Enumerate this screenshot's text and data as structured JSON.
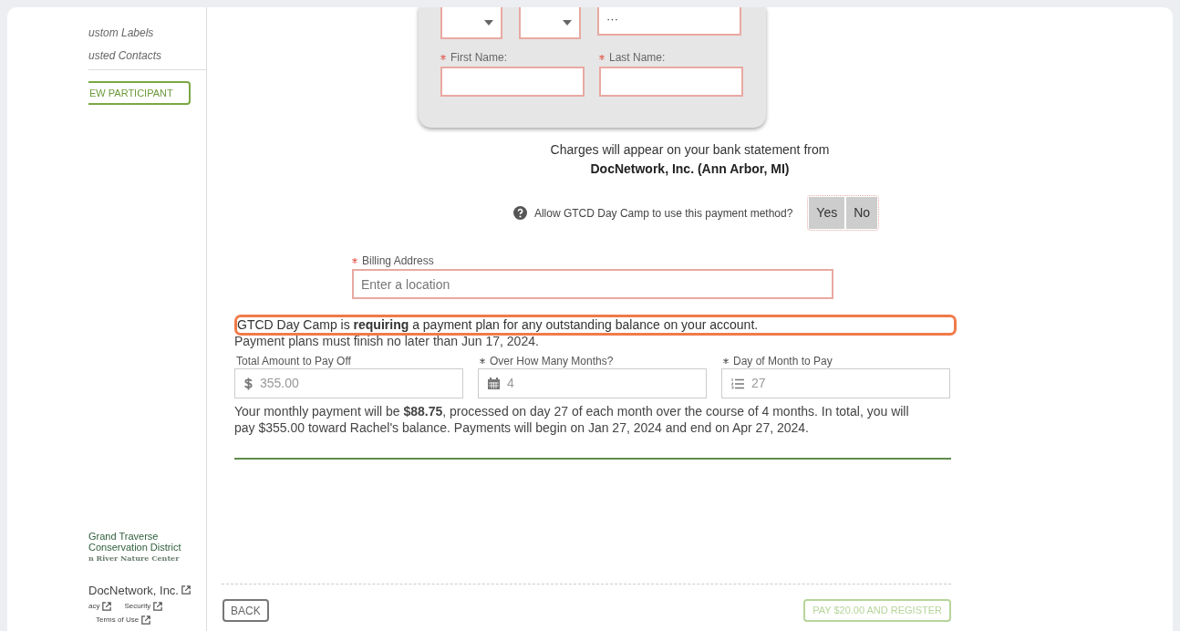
{
  "sidebar": {
    "items": [
      {
        "label": "ustom Labels"
      },
      {
        "label": "usted Contacts"
      }
    ],
    "new_participant_button": "EW PARTICIPANT",
    "logo": {
      "line_1": "Grand Traverse",
      "line_2": "Conservation District",
      "line_3": "n River Nature Center"
    },
    "footer": {
      "company_link": "DocNetwork, Inc.",
      "links": [
        "acy",
        "Security"
      ],
      "terms_link": "Terms of Use"
    }
  },
  "card_form": {
    "field_value": "···",
    "fields": [
      {
        "label": "First Name:",
        "required": true
      },
      {
        "label": "Last Name:",
        "required": true
      }
    ]
  },
  "bank_statement": {
    "text": "Charges will appear on your bank statement from",
    "merchant": "DocNetwork, Inc. (Ann Arbor, MI)"
  },
  "allow_payment": {
    "question": "Allow GTCD Day Camp to use this payment method?",
    "options": [
      {
        "label": "Yes",
        "selected": false
      },
      {
        "label": "No",
        "selected": false
      }
    ]
  },
  "billing_address": {
    "label": "Billing Address",
    "required": true,
    "placeholder": "Enter a location"
  },
  "payment_plan": {
    "notice": "GTCD Day Camp is **requiring** a payment plan for any outstanding balance on your account.",
    "deadline": "Payment plans must finish no later than Jun 17, 2024.",
    "fields": [
      {
        "label": "Total Amount to Pay Off",
        "required": false,
        "kind": "dollar",
        "value": "355.00"
      },
      {
        "label": "Over How Many Months?",
        "required": true,
        "kind": "calendar",
        "value": "4"
      },
      {
        "label": "Day of Month to Pay",
        "required": true,
        "kind": "list",
        "value": "27"
      }
    ],
    "summary": "Your monthly payment will be **$88.75**, processed on day 27 of each month over the course of 4 months. In total, you will pay $355.00 toward Rachel's balance. Payments will begin on Jan 27, 2024 and end on Apr 27, 2024."
  },
  "footer_buttons": {
    "back": "BACK",
    "pay": "PAY $20.00 AND REGISTER"
  }
}
